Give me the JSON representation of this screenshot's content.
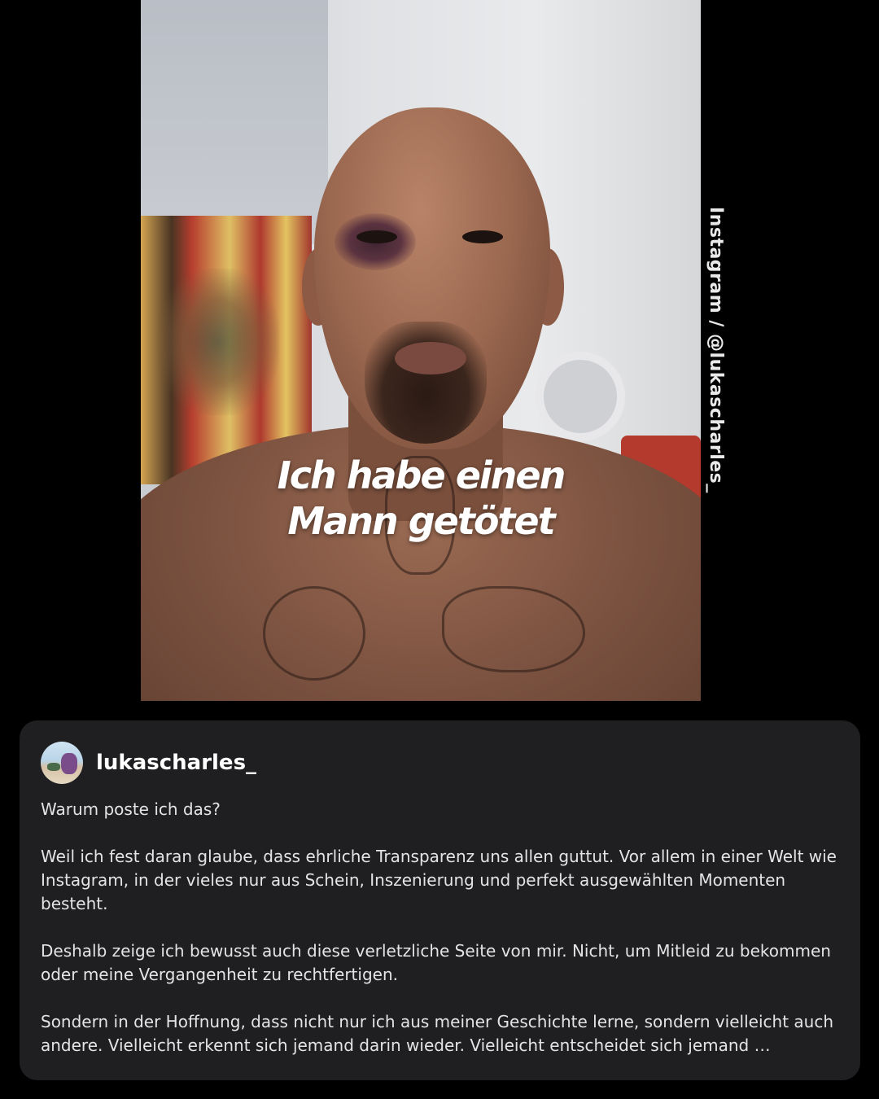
{
  "post": {
    "overlay_title_line1": "Ich habe einen",
    "overlay_title_line2": "Mann getötet",
    "credit": "Instagram / @lukascharles_"
  },
  "caption_card": {
    "username": "lukascharles_",
    "paragraphs": [
      "Warum poste ich das?",
      "Weil ich fest daran glaube, dass ehrliche Transparenz uns allen guttut. Vor allem in einer Welt wie Instagram, in der vieles nur aus Schein, Inszenierung und perfekt ausgewählten Momenten besteht.",
      "Deshalb zeige ich bewusst auch diese verletzliche Seite von mir. Nicht, um Mitleid zu bekommen oder meine Vergangenheit zu rechtfertigen.",
      "Sondern in der Hoffnung, dass nicht nur ich aus meiner Geschichte lerne, sondern vielleicht auch andere. Vielleicht erkennt sich jemand darin wieder. Vielleicht entscheidet sich jemand …"
    ]
  }
}
